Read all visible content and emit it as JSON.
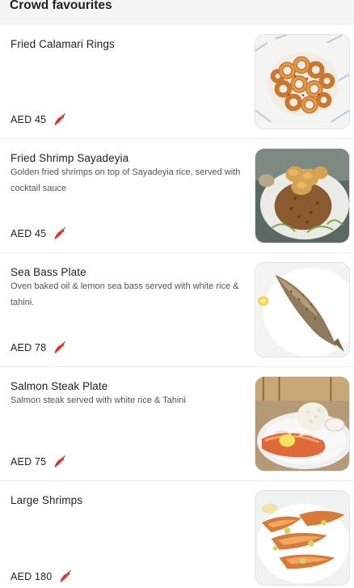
{
  "section": {
    "title": "Crowd favourites"
  },
  "items": [
    {
      "name": "Fried Calamari Rings",
      "description": "",
      "price": "AED 45",
      "icon": "chili-icon",
      "image": "fried-calamari-image"
    },
    {
      "name": "Fried Shrimp Sayadeyia",
      "description": "Golden fried shrimps on top of Sayadeyia rice, served with cocktail sauce",
      "price": "AED 45",
      "icon": "chili-icon",
      "image": "shrimp-sayadeyia-image"
    },
    {
      "name": "Sea Bass Plate",
      "description": "Oven baked oil & lemon sea bass served with white rice & tahini.",
      "price": "AED 78",
      "icon": "chili-icon",
      "image": "sea-bass-image"
    },
    {
      "name": "Salmon Steak Plate",
      "description": "Salmon steak served with white rice & Tahini",
      "price": "AED 75",
      "icon": "chili-icon",
      "image": "salmon-steak-image"
    },
    {
      "name": "Large Shrimps",
      "description": "",
      "price": "AED 180",
      "icon": "chili-icon",
      "image": "large-shrimps-image"
    }
  ],
  "colors": {
    "spice": "#e0332d",
    "header_bg": "#f5f5f5",
    "divider": "#ececec"
  }
}
